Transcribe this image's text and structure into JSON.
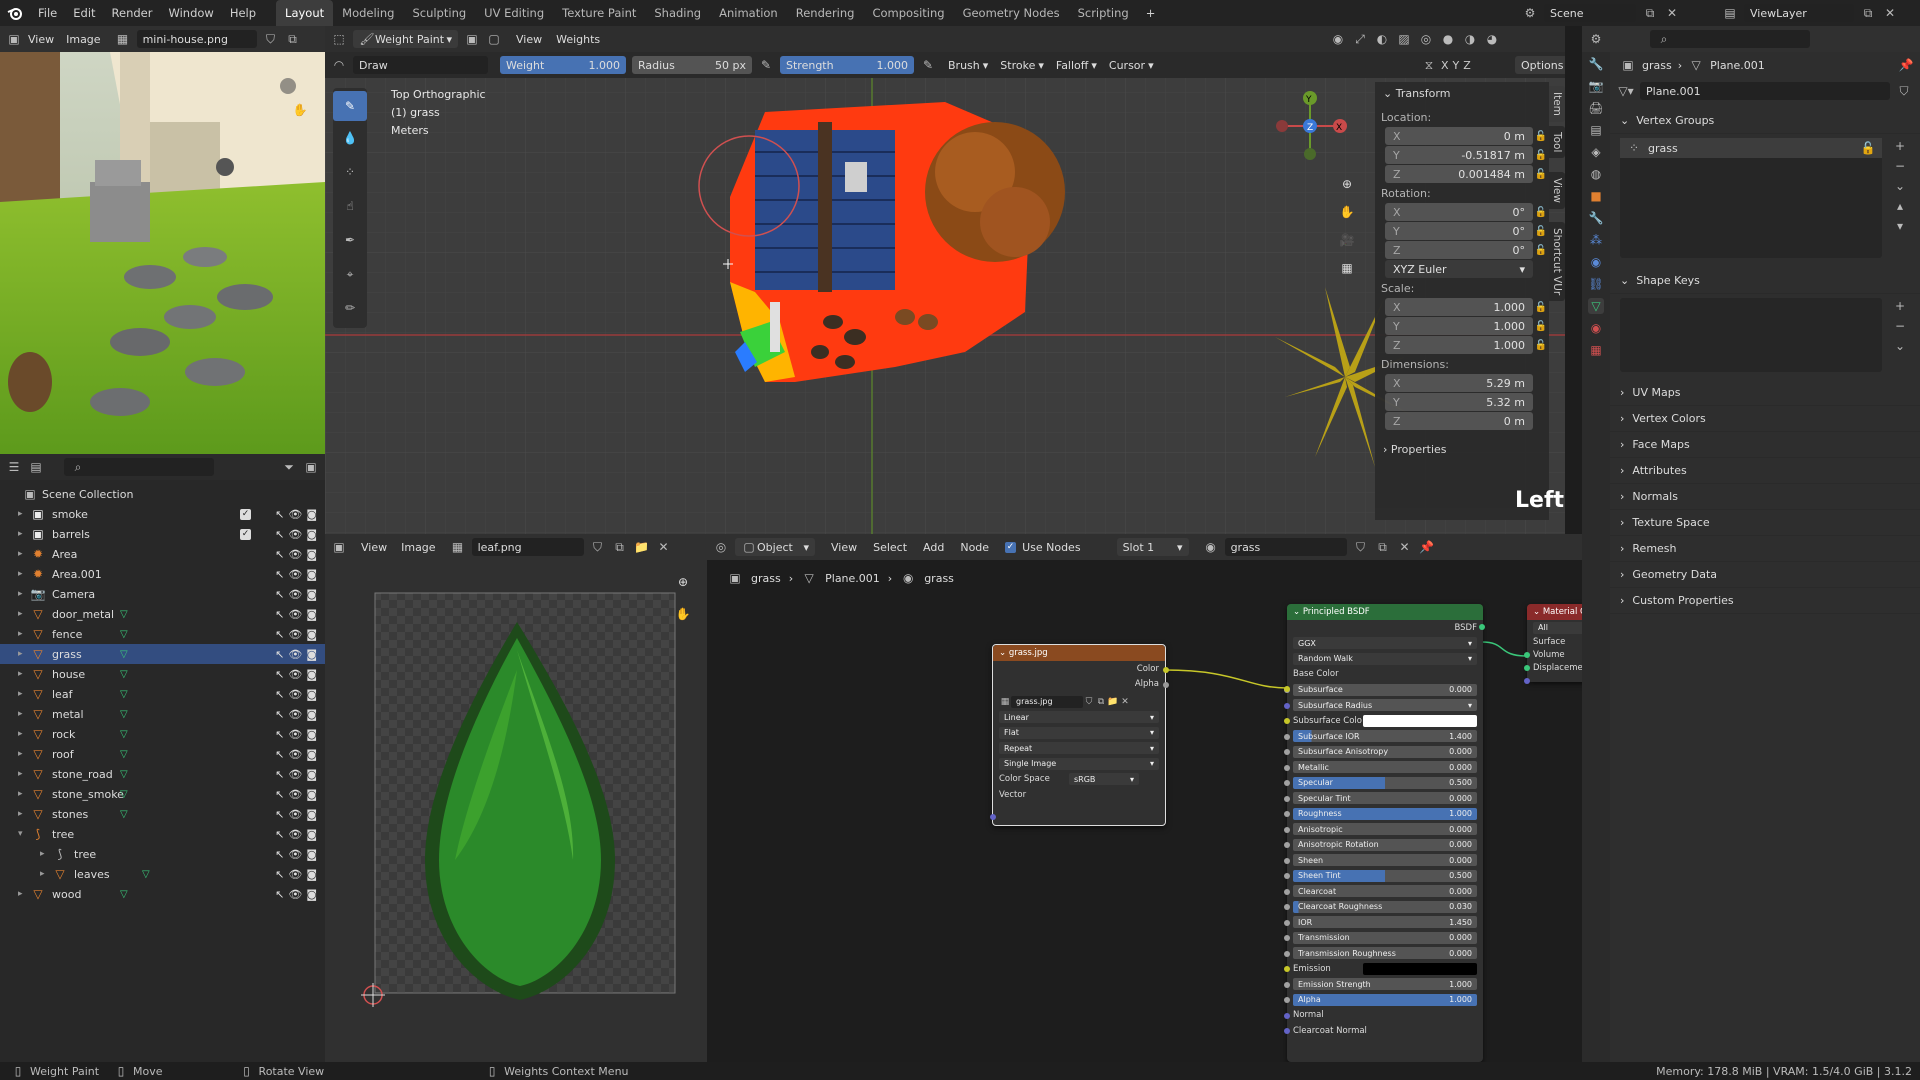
{
  "topbar": {
    "menus": [
      "File",
      "Edit",
      "Render",
      "Window",
      "Help"
    ],
    "workspaces": [
      "Layout",
      "Modeling",
      "Sculpting",
      "UV Editing",
      "Texture Paint",
      "Shading",
      "Animation",
      "Rendering",
      "Compositing",
      "Geometry Nodes",
      "Scripting"
    ],
    "active_workspace": "Layout",
    "scene": "Scene",
    "view_layer": "ViewLayer"
  },
  "image_viewer": {
    "menus": [
      "View",
      "Image"
    ],
    "image_name": "mini-house.png"
  },
  "viewport": {
    "mode": "Weight Paint",
    "menus": [
      "View",
      "Weights"
    ],
    "tool_label": "Draw",
    "weight_label": "Weight",
    "weight_value": "1.000",
    "weight_fraction": 1.0,
    "radius_label": "Radius",
    "radius_value": "50 px",
    "strength_label": "Strength",
    "strength_value": "1.000",
    "strength_fraction": 1.0,
    "dropdowns": [
      "Brush",
      "Stroke",
      "Falloff",
      "Cursor"
    ],
    "options": "Options",
    "overlay_line1": "Top Orthographic",
    "overlay_line2": "(1) grass",
    "overlay_line3": "Meters",
    "corner_text": "Left",
    "axes": {
      "x": "X",
      "y": "Y",
      "z": "Z"
    },
    "side_tabs": [
      "Item",
      "Tool",
      "View",
      "Shortcut VUr"
    ]
  },
  "transform": {
    "title": "Transform",
    "location_label": "Location:",
    "location": [
      {
        "axis": "X",
        "value": "0 m"
      },
      {
        "axis": "Y",
        "value": "-0.51817 m"
      },
      {
        "axis": "Z",
        "value": "0.001484 m"
      }
    ],
    "rotation_label": "Rotation:",
    "rotation": [
      {
        "axis": "X",
        "value": "0°"
      },
      {
        "axis": "Y",
        "value": "0°"
      },
      {
        "axis": "Z",
        "value": "0°"
      }
    ],
    "rotation_mode": "XYZ Euler",
    "scale_label": "Scale:",
    "scale": [
      {
        "axis": "X",
        "value": "1.000"
      },
      {
        "axis": "Y",
        "value": "1.000"
      },
      {
        "axis": "Z",
        "value": "1.000"
      }
    ],
    "dimensions_label": "Dimensions:",
    "dimensions": [
      {
        "axis": "X",
        "value": "5.29 m"
      },
      {
        "axis": "Y",
        "value": "5.32 m"
      },
      {
        "axis": "Z",
        "value": "0 m"
      }
    ],
    "properties": "Properties"
  },
  "outliner": {
    "root": "Scene Collection",
    "items": [
      {
        "name": "smoke",
        "type": "collection",
        "indent": 1
      },
      {
        "name": "barrels",
        "type": "collection",
        "indent": 1
      },
      {
        "name": "Area",
        "type": "light",
        "indent": 1
      },
      {
        "name": "Area.001",
        "type": "light",
        "indent": 1
      },
      {
        "name": "Camera",
        "type": "camera",
        "indent": 1
      },
      {
        "name": "door_metal",
        "type": "mesh",
        "indent": 1
      },
      {
        "name": "fence",
        "type": "mesh",
        "indent": 1
      },
      {
        "name": "grass",
        "type": "mesh",
        "indent": 1,
        "selected": true
      },
      {
        "name": "house",
        "type": "mesh",
        "indent": 1
      },
      {
        "name": "leaf",
        "type": "mesh",
        "indent": 1
      },
      {
        "name": "metal",
        "type": "mesh",
        "indent": 1
      },
      {
        "name": "rock",
        "type": "mesh",
        "indent": 1
      },
      {
        "name": "roof",
        "type": "mesh",
        "indent": 1
      },
      {
        "name": "stone_road",
        "type": "mesh",
        "indent": 1
      },
      {
        "name": "stone_smoke",
        "type": "mesh",
        "indent": 1
      },
      {
        "name": "stones",
        "type": "mesh",
        "indent": 1
      },
      {
        "name": "tree",
        "type": "armature",
        "indent": 1
      },
      {
        "name": "tree",
        "type": "bone",
        "indent": 2
      },
      {
        "name": "leaves",
        "type": "mesh",
        "indent": 2
      },
      {
        "name": "wood",
        "type": "mesh",
        "indent": 1
      }
    ]
  },
  "uv_editor": {
    "menus": [
      "View",
      "Image"
    ],
    "image_name": "leaf.png"
  },
  "node_editor": {
    "object_mode": "Object",
    "menus": [
      "View",
      "Select",
      "Add",
      "Node"
    ],
    "use_nodes": "Use Nodes",
    "slot": "Slot 1",
    "material": "grass",
    "breadcrumb": [
      "grass",
      "Plane.001",
      "grass"
    ],
    "image_node": {
      "title": "grass.jpg",
      "outputs": [
        "Color",
        "Alpha"
      ],
      "image": "grass.jpg",
      "options": [
        "Linear",
        "Flat",
        "Repeat",
        "Single Image"
      ],
      "color_space_label": "Color Space",
      "color_space": "sRGB",
      "input": "Vector"
    },
    "bsdf_node": {
      "title": "Principled BSDF",
      "output": "BSDF",
      "distribution": "GGX",
      "subsurface_method": "Random Walk",
      "base_color": "Base Color",
      "rows": [
        {
          "label": "Subsurface",
          "value": "0.000",
          "fill": 0
        },
        {
          "label": "Subsurface Radius",
          "value": "",
          "fill": 0
        },
        {
          "label": "Subsurface Colo",
          "value": "",
          "fill": 0,
          "color": "#ffffff"
        },
        {
          "label": "Subsurface IOR",
          "value": "1.400",
          "fill": 0.1
        },
        {
          "label": "Subsurface Anisotropy",
          "value": "0.000",
          "fill": 0
        },
        {
          "label": "Metallic",
          "value": "0.000",
          "fill": 0
        },
        {
          "label": "Specular",
          "value": "0.500",
          "fill": 0.5
        },
        {
          "label": "Specular Tint",
          "value": "0.000",
          "fill": 0
        },
        {
          "label": "Roughness",
          "value": "1.000",
          "fill": 1
        },
        {
          "label": "Anisotropic",
          "value": "0.000",
          "fill": 0
        },
        {
          "label": "Anisotropic Rotation",
          "value": "0.000",
          "fill": 0
        },
        {
          "label": "Sheen",
          "value": "0.000",
          "fill": 0
        },
        {
          "label": "Sheen Tint",
          "value": "0.500",
          "fill": 0.5
        },
        {
          "label": "Clearcoat",
          "value": "0.000",
          "fill": 0
        },
        {
          "label": "Clearcoat Roughness",
          "value": "0.030",
          "fill": 0.03
        },
        {
          "label": "IOR",
          "value": "1.450",
          "fill": 0
        },
        {
          "label": "Transmission",
          "value": "0.000",
          "fill": 0
        },
        {
          "label": "Transmission Roughness",
          "value": "0.000",
          "fill": 0
        },
        {
          "label": "Emission",
          "value": "",
          "fill": 0,
          "color": "#000000"
        },
        {
          "label": "Emission Strength",
          "value": "1.000",
          "fill": 0
        },
        {
          "label": "Alpha",
          "value": "1.000",
          "fill": 1
        },
        {
          "label": "Normal",
          "value": "",
          "fill": 0
        },
        {
          "label": "Clearcoat Normal",
          "value": "",
          "fill": 0
        }
      ]
    },
    "output_node": {
      "title": "Material Output",
      "target": "All",
      "inputs": [
        "Surface",
        "Volume",
        "Displacement"
      ]
    }
  },
  "properties": {
    "breadcrumb_object": "grass",
    "breadcrumb_data": "Plane.001",
    "data_name": "Plane.001",
    "vertex_groups_title": "Vertex Groups",
    "vertex_group": "grass",
    "shape_keys_title": "Shape Keys",
    "sections": [
      "UV Maps",
      "Vertex Colors",
      "Face Maps",
      "Attributes",
      "Normals",
      "Texture Space",
      "Remesh",
      "Geometry Data",
      "Custom Properties"
    ]
  },
  "statusbar": {
    "left": [
      "Weight Paint",
      "Move",
      "Rotate View",
      "Weights Context Menu"
    ],
    "right": "Memory: 178.8 MiB | VRAM: 1.5/4.0 GiB | 3.1.2"
  }
}
